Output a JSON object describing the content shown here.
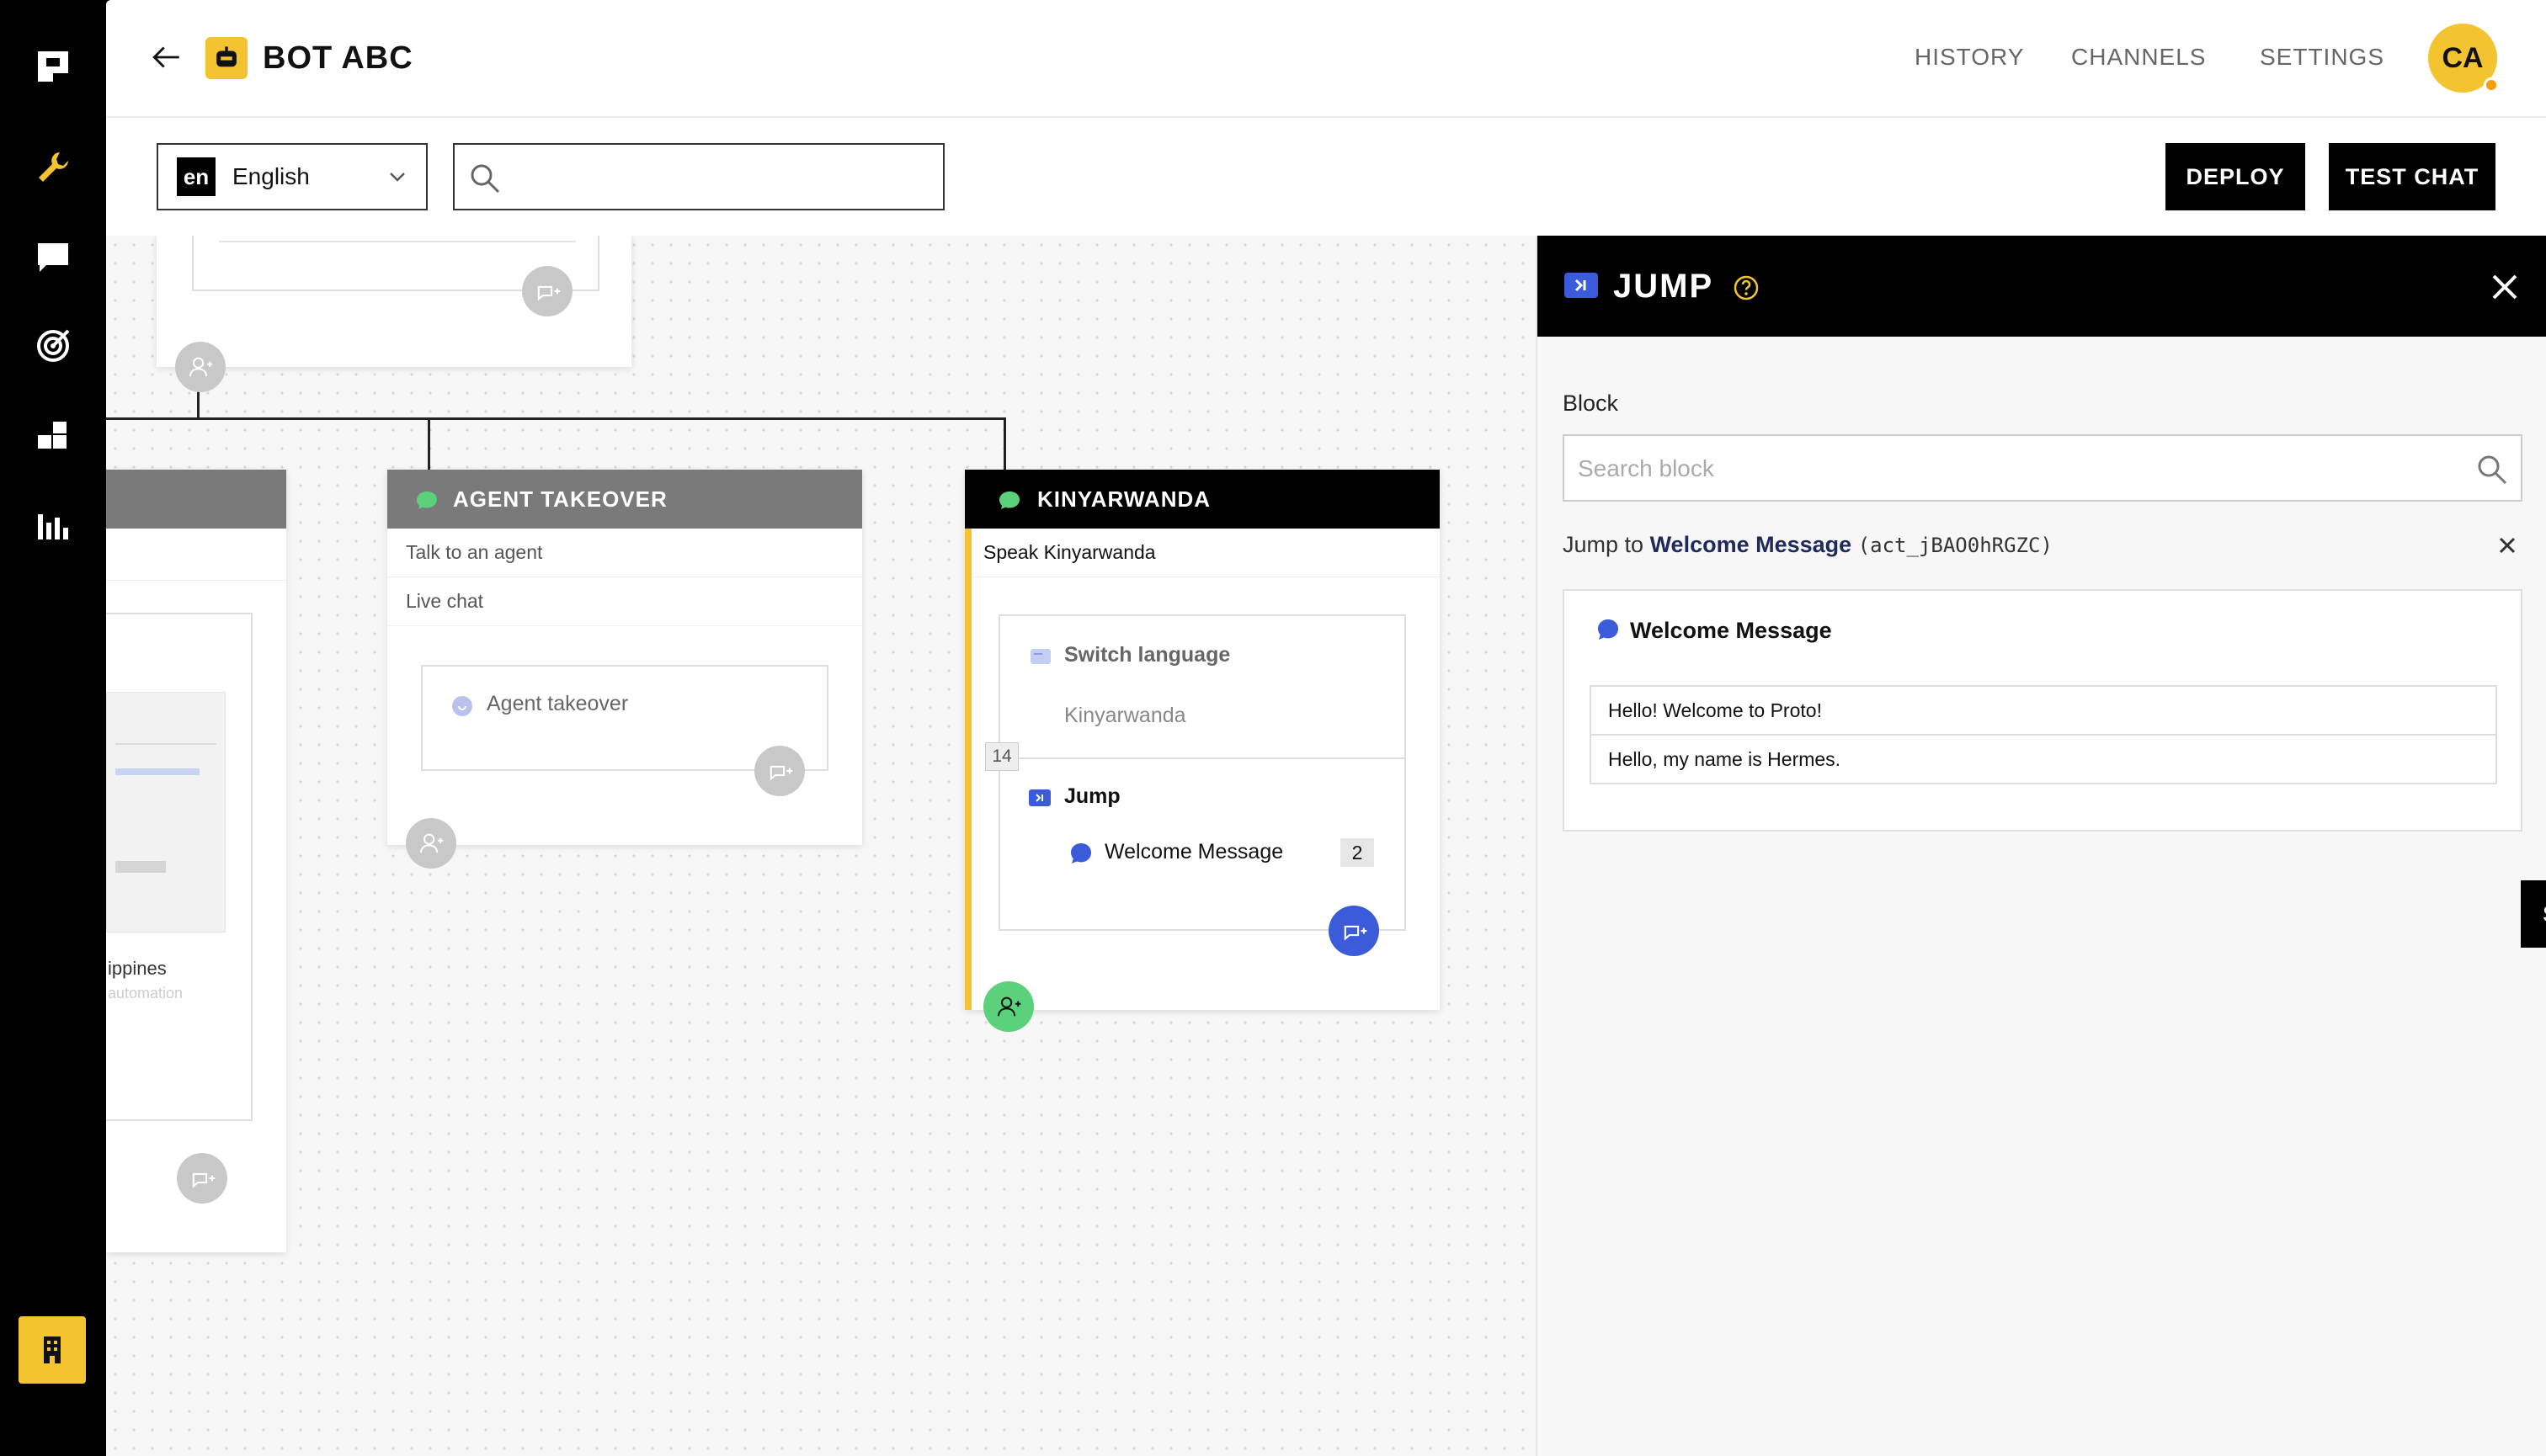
{
  "header": {
    "bot_name": "BOT ABC",
    "nav": [
      "HISTORY",
      "CHANNELS",
      "SETTINGS"
    ],
    "avatar_initials": "CA"
  },
  "toolbar": {
    "lang_code": "en",
    "lang_name": "English",
    "search_value": "",
    "deploy_label": "DEPLOY",
    "test_chat_label": "TEST CHAT"
  },
  "canvas": {
    "left_card": {
      "footer_text": "ippines",
      "footer_sub": "automation"
    },
    "agent_card": {
      "title": "AGENT TAKEOVER",
      "triggers": [
        "Talk to an agent",
        "Live chat"
      ],
      "action": "Agent takeover"
    },
    "kin_card": {
      "title": "KINYARWANDA",
      "trigger": "Speak Kinyarwanda",
      "switch_label": "Switch language",
      "switch_value": "Kinyarwanda",
      "step_badge": "14",
      "jump_label": "Jump",
      "jump_target": "Welcome Message",
      "jump_count": "2"
    }
  },
  "panel": {
    "title": "JUMP",
    "block_label": "Block",
    "search_placeholder": "Search block",
    "jump_prefix": "Jump to",
    "jump_target": "Welcome Message",
    "jump_id": "(act_jBAO0hRGZC)",
    "preview_title": "Welcome Message",
    "messages": [
      "Hello! Welcome to Proto!",
      "Hello, my name is Hermes."
    ],
    "save_label": "SAVE"
  },
  "colors": {
    "accent_yellow": "#f4c430",
    "accent_blue": "#3b5bdb",
    "accent_green": "#5ad17a",
    "gray_header": "#7a7a7a"
  }
}
